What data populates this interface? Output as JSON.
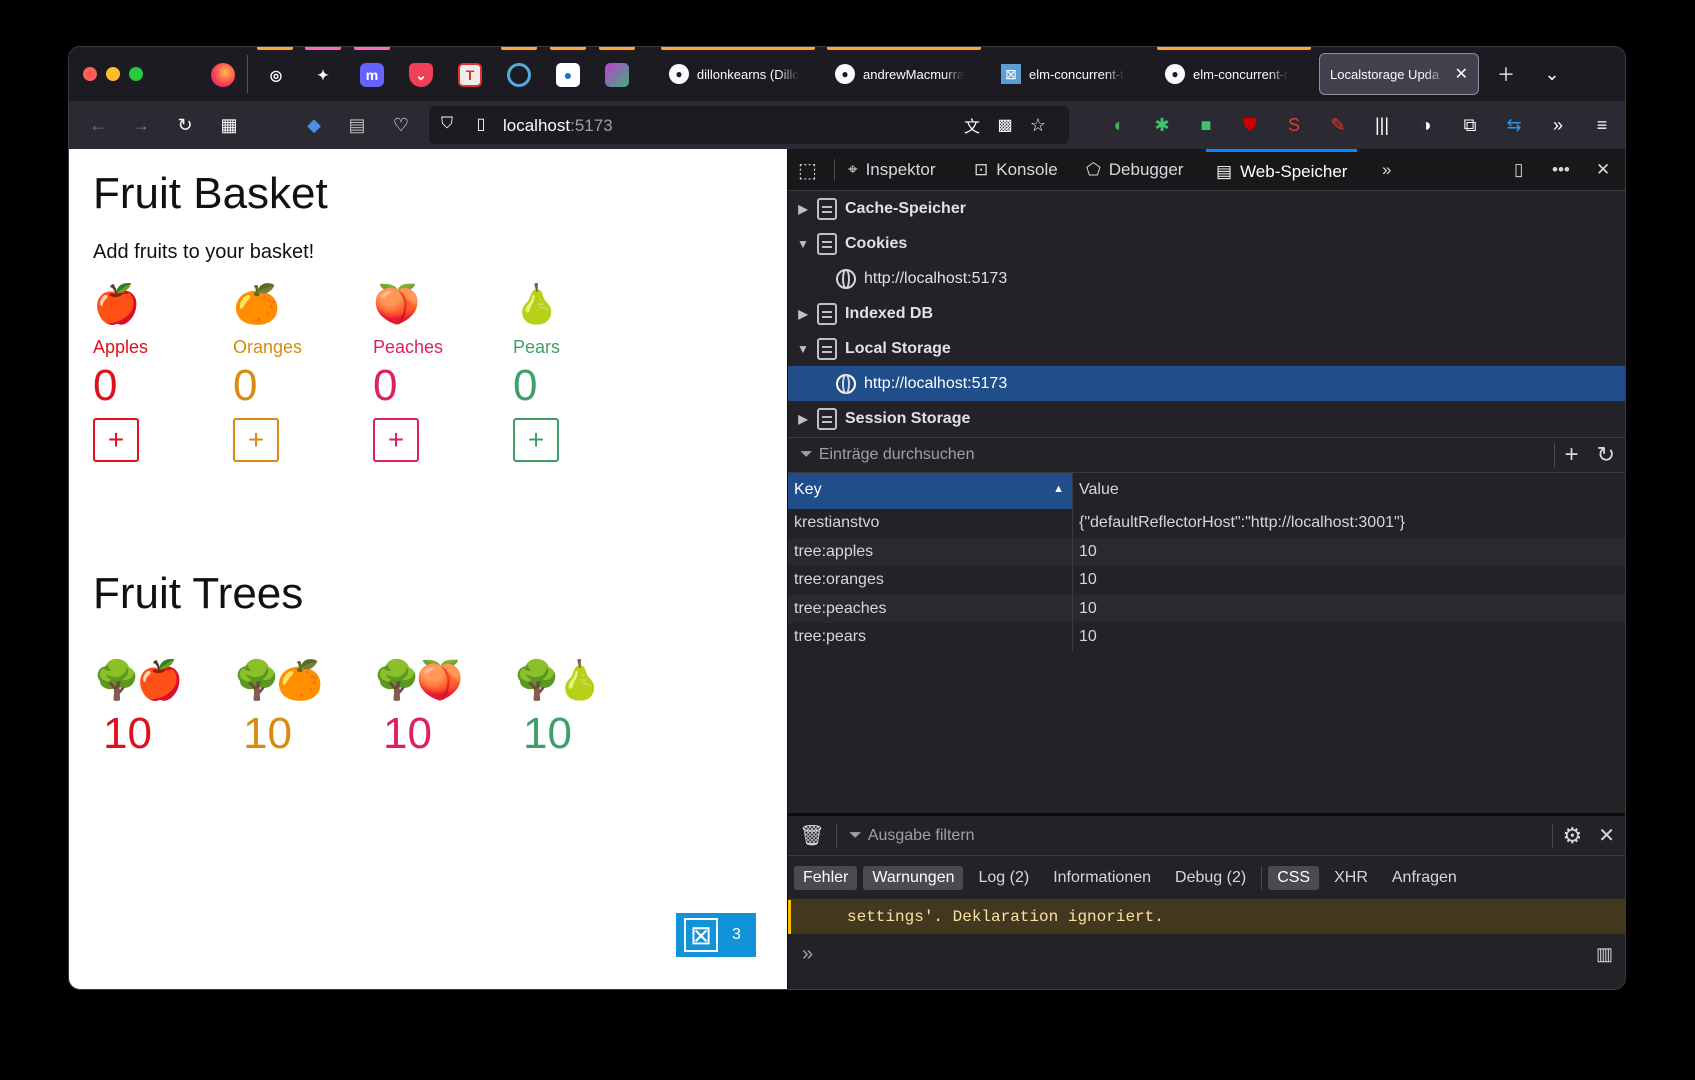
{
  "browser": {
    "tabs": [
      {
        "label": "dillonkearns (Dillo",
        "icon": "github-icon"
      },
      {
        "label": "andrewMacmurra",
        "icon": "github-icon"
      },
      {
        "label": "elm-concurrent-t",
        "icon": "elm-icon"
      },
      {
        "label": "elm-concurrent-t",
        "icon": "github-icon"
      },
      {
        "label": "Localstorage Upda",
        "icon": "none",
        "active": true
      }
    ],
    "url_host": "localhost",
    "url_port": ":5173"
  },
  "page": {
    "basket_title": "Fruit Basket",
    "basket_subtitle": "Add fruits to your basket!",
    "fruits": [
      {
        "emoji": "🍎",
        "name": "Apples",
        "count": "0",
        "color": "#e0101f"
      },
      {
        "emoji": "🍊",
        "name": "Oranges",
        "count": "0",
        "color": "#d98a13"
      },
      {
        "emoji": "🍑",
        "name": "Peaches",
        "count": "0",
        "color": "#e0205a"
      },
      {
        "emoji": "🍐",
        "name": "Pears",
        "count": "0",
        "color": "#3f9f6a"
      }
    ],
    "add_label": "+",
    "trees_title": "Fruit Trees",
    "trees": [
      {
        "emoji": "🌳🍎",
        "count": "10"
      },
      {
        "emoji": "🌳🍊",
        "count": "10"
      },
      {
        "emoji": "🌳🍑",
        "count": "10"
      },
      {
        "emoji": "🌳🍐",
        "count": "10"
      }
    ],
    "elm_badge_count": "3"
  },
  "devtools": {
    "tools": [
      "Inspektor",
      "Konsole",
      "Debugger",
      "Web-Speicher"
    ],
    "storage_tree": [
      {
        "label": "Cache-Speicher",
        "expanded": false
      },
      {
        "label": "Cookies",
        "expanded": true
      },
      {
        "label": "http://localhost:5173",
        "child": true
      },
      {
        "label": "Indexed DB",
        "expanded": false
      },
      {
        "label": "Local Storage",
        "expanded": true
      },
      {
        "label": "http://localhost:5173",
        "child": true,
        "selected": true
      },
      {
        "label": "Session Storage",
        "expanded": false
      }
    ],
    "filter_placeholder": "Einträge durchsuchen",
    "table": {
      "key_header": "Key",
      "value_header": "Value",
      "rows": [
        {
          "key": "krestianstvo",
          "value": "{\"defaultReflectorHost\":\"http://localhost:3001\"}"
        },
        {
          "key": "tree:apples",
          "value": "10"
        },
        {
          "key": "tree:oranges",
          "value": "10"
        },
        {
          "key": "tree:peaches",
          "value": "10"
        },
        {
          "key": "tree:pears",
          "value": "10"
        }
      ]
    },
    "console": {
      "filter_placeholder": "Ausgabe filtern",
      "levels": [
        {
          "label": "Fehler",
          "on": true
        },
        {
          "label": "Warnungen",
          "on": true
        },
        {
          "label": "Log (2)",
          "on": false
        },
        {
          "label": "Informationen",
          "on": false
        },
        {
          "label": "Debug (2)",
          "on": false
        },
        {
          "label": "CSS",
          "on": true
        },
        {
          "label": "XHR",
          "on": false
        },
        {
          "label": "Anfragen",
          "on": false
        }
      ],
      "message": "settings'.  Deklaration ignoriert."
    }
  }
}
